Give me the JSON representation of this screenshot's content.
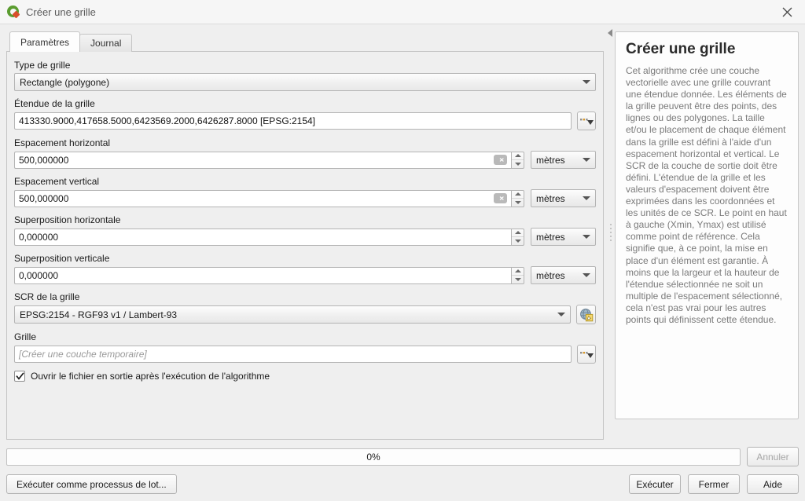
{
  "window": {
    "title": "Créer une grille",
    "icon": "qgis-logo-icon",
    "close_label": "×"
  },
  "tabs": [
    {
      "label": "Paramètres",
      "active": true
    },
    {
      "label": "Journal",
      "active": false
    }
  ],
  "form": {
    "grid_type": {
      "label": "Type de grille",
      "value": "Rectangle (polygone)"
    },
    "extent": {
      "label": "Étendue de la grille",
      "value": "413330.9000,417658.5000,6423569.2000,6426287.8000 [EPSG:2154]",
      "browse_label": "..."
    },
    "h_spacing": {
      "label": "Espacement horizontal",
      "value": "500,000000",
      "unit": "mètres",
      "has_clear": true
    },
    "v_spacing": {
      "label": "Espacement vertical",
      "value": "500,000000",
      "unit": "mètres",
      "has_clear": true
    },
    "h_overlay": {
      "label": "Superposition horizontale",
      "value": "0,000000",
      "unit": "mètres",
      "has_clear": false
    },
    "v_overlay": {
      "label": "Superposition verticale",
      "value": "0,000000",
      "unit": "mètres",
      "has_clear": false
    },
    "crs": {
      "label": "SCR de la grille",
      "value": "EPSG:2154 - RGF93 v1 / Lambert-93"
    },
    "output": {
      "label": "Grille",
      "placeholder": "[Créer une couche temporaire]",
      "value": "",
      "browse_label": "..."
    },
    "open_output": {
      "label": "Ouvrir le fichier en sortie après l'exécution de l'algorithme",
      "checked": true
    }
  },
  "help": {
    "title": "Créer une grille",
    "body": "Cet algorithme crée une couche vectorielle avec une grille couvrant une étendue donnée. Les éléments de la grille peuvent être des points, des lignes ou des polygones. La taille et/ou le placement de chaque élément dans la grille est défini à l'aide d'un espacement horizontal et vertical. Le SCR de la couche de sortie doit être défini. L'étendue de la grille et les valeurs d'espacement doivent être exprimées dans les coordonnées et les unités de ce SCR. Le point en haut à gauche (Xmin, Ymax) est utilisé comme point de référence. Cela signifie que, à ce point, la mise en place d'un élément est garantie. À moins que la largeur et la hauteur de l'étendue sélectionnée ne soit un multiple de l'espacement sélectionné, cela n'est pas vrai pour les autres points qui définissent cette étendue."
  },
  "progress": {
    "percent_label": "0%",
    "percent_value": 0
  },
  "buttons": {
    "cancel": "Annuler",
    "batch": "Exécuter comme processus de lot...",
    "run": "Exécuter",
    "close": "Fermer",
    "help": "Aide"
  },
  "colors": {
    "accent_green": "#5a9c2f",
    "accent_red": "#d94f2b",
    "window_bg": "#efefef",
    "help_text": "#7a7a7a"
  }
}
